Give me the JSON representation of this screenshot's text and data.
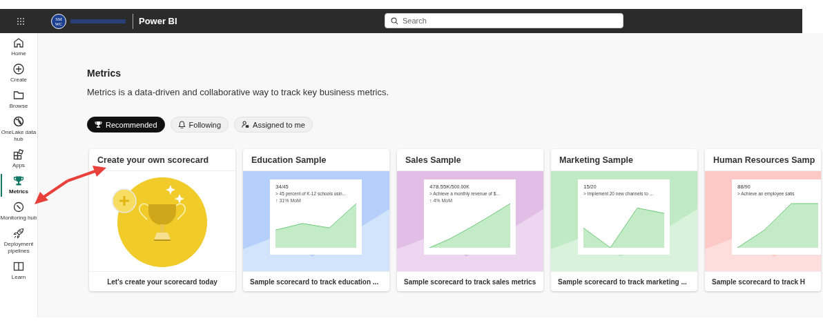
{
  "top_bar": {
    "logo_text": "SM WC",
    "product": "Power BI",
    "search": {
      "placeholder": "Search"
    }
  },
  "sidebar": {
    "items": [
      {
        "label": "Home",
        "selected": false
      },
      {
        "label": "Create",
        "selected": false
      },
      {
        "label": "Browse",
        "selected": false
      },
      {
        "label": "OneLake data hub",
        "selected": false
      },
      {
        "label": "Apps",
        "selected": false
      },
      {
        "label": "Metrics",
        "selected": true
      },
      {
        "label": "Monitoring hub",
        "selected": false
      },
      {
        "label": "Deployment pipelines",
        "selected": false
      },
      {
        "label": "Learn",
        "selected": false
      }
    ]
  },
  "page": {
    "title": "Metrics",
    "description": "Metrics is a data-driven and collaborative way to track key business metrics.",
    "tabs": [
      {
        "label": "Recommended",
        "selected": true
      },
      {
        "label": "Following",
        "selected": false
      },
      {
        "label": "Assigned to me",
        "selected": false
      }
    ],
    "cards": [
      {
        "kind": "create",
        "title": "Create your own scorecard",
        "footer": "Let's create your scorecard today"
      },
      {
        "kind": "sample",
        "title": "Education Sample",
        "color": "#b4d0fa",
        "value": "34",
        "target": "/45",
        "goal": "> 45 percent of K-12 schools usin...",
        "change": "↑ 31% MoM",
        "footer": "Sample scorecard to track education ..."
      },
      {
        "kind": "sample",
        "title": "Sales Sample",
        "color": "#e2bde6",
        "value": "478.55K",
        "target": "/500.00K",
        "goal": "> Achieve a monthly revenue of $...",
        "change": "↑ 4% MoM",
        "footer": "Sample scorecard to track sales metrics"
      },
      {
        "kind": "sample",
        "title": "Marketing Sample",
        "color": "#bfeac3",
        "value": "15",
        "target": "/20",
        "goal": "> Implement 20 new channels to ...",
        "footer": "Sample scorecard to track marketing ..."
      },
      {
        "kind": "sample",
        "title": "Human Resources Samp",
        "color": "#fcc9c7",
        "value": "88",
        "target": "/90",
        "goal": "> Achieve an employee satis",
        "footer": "Sample scorecard to track H"
      }
    ]
  }
}
